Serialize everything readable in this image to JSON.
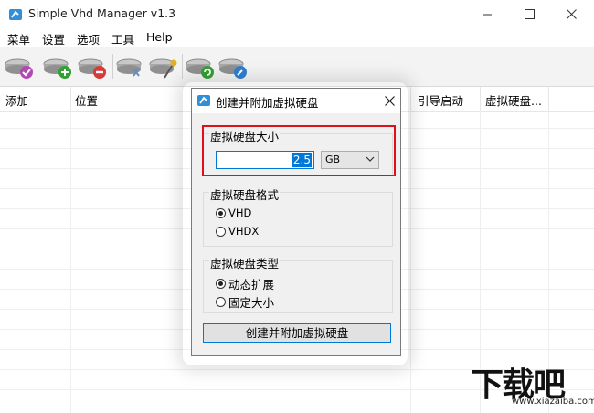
{
  "window": {
    "title": "Simple Vhd Manager v1.3",
    "minimize_glyph": "—",
    "maximize_glyph": "☐",
    "close_glyph": "✕"
  },
  "menu": [
    "菜单",
    "设置",
    "选项",
    "工具",
    "Help"
  ],
  "toolbar": {
    "buttons": [
      {
        "icon": "disk-check-icon",
        "color": "#b04ab0"
      },
      {
        "icon": "disk-add-icon",
        "color": "#33a033"
      },
      {
        "icon": "disk-remove-icon",
        "color": "#d83a3a"
      },
      {
        "icon": "disk-attach-icon",
        "color": "#6a8bc0"
      },
      {
        "icon": "disk-magic-icon",
        "color": "#e0b020"
      },
      {
        "icon": "disk-refresh-icon",
        "color": "#33a033"
      },
      {
        "icon": "disk-settings-icon",
        "color": "#2f7fd0"
      }
    ]
  },
  "list": {
    "columns": [
      "添加",
      "位置",
      "引导启动",
      "虚拟硬盘..."
    ]
  },
  "dialog": {
    "title": "创建并附加虚拟硬盘",
    "size_group": {
      "label": "虚拟硬盘大小",
      "value": "2.5",
      "unit": "GB"
    },
    "format_group": {
      "label": "虚拟硬盘格式",
      "options": [
        {
          "label": "VHD",
          "selected": true
        },
        {
          "label": "VHDX",
          "selected": false
        }
      ]
    },
    "type_group": {
      "label": "虚拟硬盘类型",
      "options": [
        {
          "label": "动态扩展",
          "selected": true
        },
        {
          "label": "固定大小",
          "selected": false
        }
      ]
    },
    "create_button": "创建并附加虚拟硬盘"
  },
  "watermark": {
    "text": "下载吧",
    "url": "www.xiazaiba.com"
  },
  "colors": {
    "accent": "#0078d7",
    "highlight": "#e0101b"
  }
}
